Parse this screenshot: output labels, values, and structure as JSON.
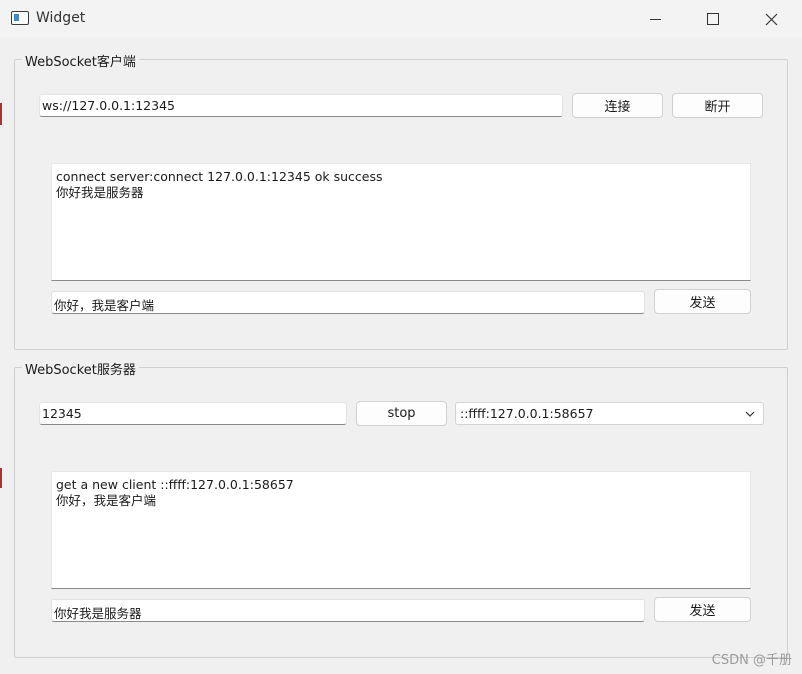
{
  "window": {
    "title": "Widget"
  },
  "client": {
    "group_title": "WebSocket客户端",
    "url": "ws://127.0.0.1:12345",
    "connect_label": "连接",
    "disconnect_label": "断开",
    "log": [
      "connect server:connect 127.0.0.1:12345 ok success",
      "你好我是服务器"
    ],
    "message": "你好，我是客户端",
    "send_label": "发送"
  },
  "server": {
    "group_title": "WebSocket服务器",
    "port": "12345",
    "stop_label": "stop",
    "selected_client": "::ffff:127.0.0.1:58657",
    "log": [
      "get a new client ::ffff:127.0.0.1:58657",
      "你好，我是客户端"
    ],
    "message": "你好我是服务器",
    "send_label": "发送"
  },
  "watermark": "CSDN @千册"
}
